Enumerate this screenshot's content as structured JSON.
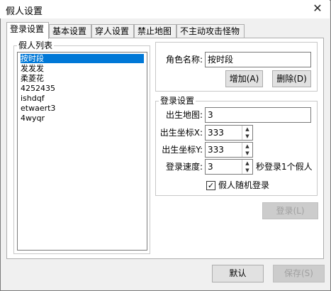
{
  "window": {
    "title": "假人设置",
    "close_glyph": "✕"
  },
  "tabs": [
    {
      "label": "登录设置",
      "active": true
    },
    {
      "label": "基本设置",
      "active": false
    },
    {
      "label": "穿人设置",
      "active": false
    },
    {
      "label": "禁止地图",
      "active": false
    },
    {
      "label": "不主动攻击怪物",
      "active": false
    }
  ],
  "bot_list": {
    "legend": "假人列表",
    "items": [
      "按时段",
      "发发发",
      "柔菱花",
      "4252435",
      "ishdqf",
      "etwaert3",
      "4wyqr"
    ],
    "selected_index": 0
  },
  "role": {
    "name_label": "角色名称:",
    "name_value": "按时段",
    "add_button": "增加(A)",
    "delete_button": "删除(D)"
  },
  "login": {
    "legend": "登录设置",
    "map_label": "出生地图:",
    "map_value": "3",
    "x_label": "出生坐标X:",
    "x_value": "333",
    "y_label": "出生坐标Y:",
    "y_value": "333",
    "speed_label": "登录速度:",
    "speed_value": "3",
    "speed_suffix": "秒登录1个假人",
    "random_label": "假人随机登录",
    "random_checked": true,
    "checkmark": "✓",
    "login_button": "登录(L)"
  },
  "footer": {
    "default_button": "默认",
    "save_button": "保存(S)"
  },
  "icons": {
    "spin_up": "▲",
    "spin_down": "▼"
  }
}
